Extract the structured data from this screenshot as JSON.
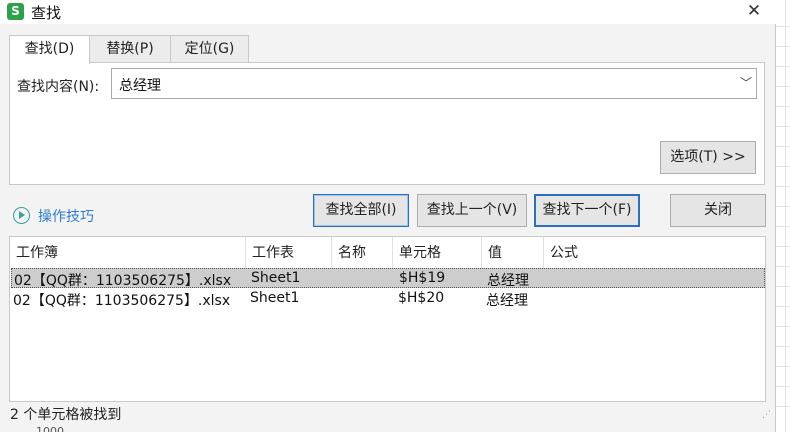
{
  "window": {
    "title": "查找",
    "app_icon": "S"
  },
  "tabs": [
    {
      "label": "查找(D)",
      "active": true
    },
    {
      "label": "替换(P)",
      "active": false
    },
    {
      "label": "定位(G)",
      "active": false
    }
  ],
  "search": {
    "label": "查找内容(N):",
    "value": "总经理"
  },
  "buttons": {
    "options": "选项(T) >>",
    "find_all": "查找全部(I)",
    "find_prev": "查找上一个(V)",
    "find_next": "查找下一个(F)",
    "close": "关闭"
  },
  "tips": {
    "label": "操作技巧"
  },
  "results": {
    "columns": [
      "工作簿",
      "工作表",
      "名称",
      "单元格",
      "值",
      "公式"
    ],
    "rows": [
      {
        "workbook": "02【QQ群：1103506275】.xlsx",
        "sheet": "Sheet1",
        "name": "",
        "cell": "$H$19",
        "value": "总经理",
        "formula": "",
        "selected": true
      },
      {
        "workbook": "02【QQ群：1103506275】.xlsx",
        "sheet": "Sheet1",
        "name": "",
        "cell": "$H$20",
        "value": "总经理",
        "formula": "",
        "selected": false
      }
    ]
  },
  "status": "2 个单元格被找到",
  "background_sheet": {
    "partial_cell_text": "1000"
  },
  "colors": {
    "accent": "#2b6fbf",
    "link": "#2b7bd1",
    "app_green": "#2ca24c",
    "selected_row": "#cdcdcd"
  }
}
